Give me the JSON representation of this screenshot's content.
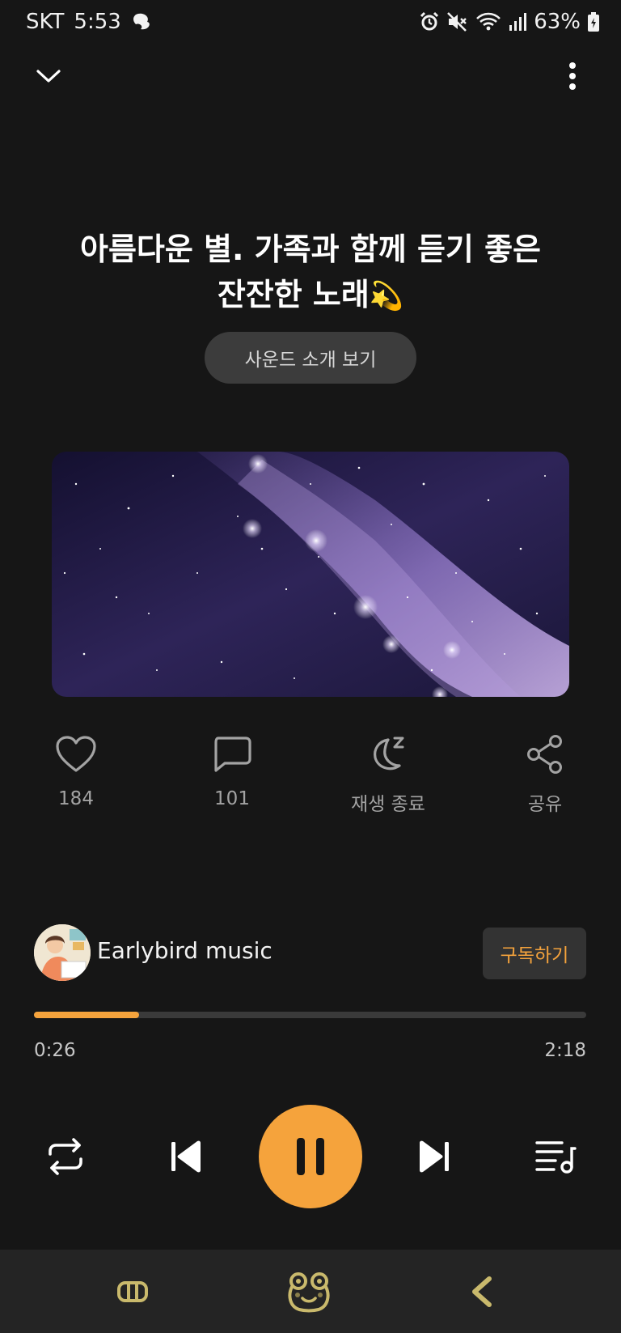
{
  "status_bar": {
    "carrier": "SKT",
    "time": "5:53",
    "battery": "63%"
  },
  "track": {
    "title_line1": "아름다운 별. 가족과 함께 듣기 좋은",
    "title_line2": "잔잔한 노래",
    "title_emoji": "💫",
    "intro_button": "사운드 소개 보기"
  },
  "actions": {
    "likes": "184",
    "comments": "101",
    "sleep_timer": "재생 종료",
    "share": "공유"
  },
  "channel": {
    "name": "Earlybird music",
    "subscribe_label": "구독하기"
  },
  "playback": {
    "current_time": "0:26",
    "total_time": "2:18",
    "progress_fraction": 0.19,
    "state": "playing"
  },
  "colors": {
    "accent": "#f5a33c",
    "background": "#161616",
    "nav_icon": "#c9b96c"
  },
  "icons": {
    "collapse": "chevron-down-icon",
    "more": "more-vertical-icon",
    "like": "heart-icon",
    "comment": "comment-icon",
    "sleep": "moon-sleep-icon",
    "share": "share-icon",
    "repeat": "repeat-icon",
    "previous": "skip-previous-icon",
    "pause": "pause-icon",
    "next": "skip-next-icon",
    "playlist": "playlist-icon",
    "nav_left": "recent-apps-icon",
    "nav_home": "home-frog-icon",
    "nav_back": "back-icon"
  }
}
